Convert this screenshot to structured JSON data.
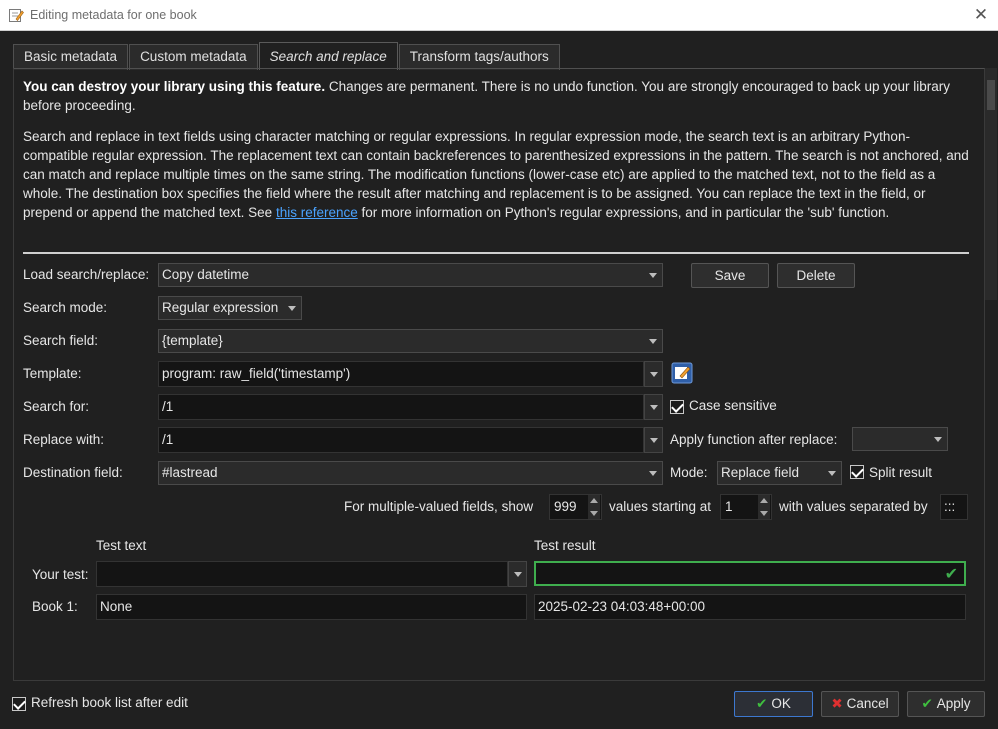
{
  "window": {
    "title": "Editing metadata for one book",
    "close_glyph": "✕"
  },
  "tabs": [
    {
      "label": "Basic metadata"
    },
    {
      "label": "Custom metadata"
    },
    {
      "label": "Search and replace"
    },
    {
      "label": "Transform tags/authors"
    }
  ],
  "warning": {
    "bold": "You can destroy your library using this feature.",
    "rest": " Changes are permanent. There is no undo function. You are strongly encouraged to back up your library before proceeding."
  },
  "description": {
    "part1": "Search and replace in text fields using character matching or regular expressions. In regular expression mode, the search text is an arbitrary Python-compatible regular expression. The replacement text can contain backreferences to parenthesized expressions in the pattern. The search is not anchored, and can match and replace multiple times on the same string. The modification functions (lower-case etc) are applied to the matched text, not to the field as a whole. The destination box specifies the field where the result after matching and replacement is to be assigned. You can replace the text in the field, or prepend or append the matched text. See ",
    "link": "this reference",
    "part2": " for more information on Python's regular expressions, and in particular the 'sub' function."
  },
  "form": {
    "load_label": "Load search/replace:",
    "load_value": "Copy datetime",
    "save_label": "Save",
    "delete_label": "Delete",
    "mode_label": "Search mode:",
    "mode_value": "Regular expression",
    "field_label": "Search field:",
    "field_value": "{template}",
    "template_label": "Template:",
    "template_value": "program: raw_field('timestamp')",
    "search_for_label": "Search for:",
    "search_for_value": "/1",
    "case_label": "Case sensitive",
    "replace_label": "Replace with:",
    "replace_value": "/1",
    "apply_fn_label": "Apply function after replace:",
    "apply_fn_value": "",
    "dest_label": "Destination field:",
    "dest_value": "#lastread",
    "dest_mode_label": "Mode:",
    "dest_mode_value": "Replace field",
    "split_label": "Split result",
    "multi_label": "For multiple-valued fields, show",
    "multi_count": "999",
    "starting_label": "values starting at",
    "starting_value": "1",
    "separated_label": "with values separated by",
    "separator_value": ":::"
  },
  "test": {
    "test_text_header": "Test text",
    "test_result_header": "Test result",
    "your_test_label": "Your test:",
    "your_test_value": "",
    "book1_label": "Book 1:",
    "book1_text": "None",
    "book1_result": "2025-02-23 04:03:48+00:00"
  },
  "footer": {
    "refresh_label": "Refresh book list after edit",
    "ok_label": "OK",
    "cancel_label": "Cancel",
    "apply_label": "Apply"
  },
  "colors": {
    "accent": "#3fae4e",
    "link": "#4aa3ff",
    "default_border": "#3d78d0"
  },
  "icons": {
    "app": "edit-metadata-icon",
    "template_editor": "template-editor-icon"
  }
}
